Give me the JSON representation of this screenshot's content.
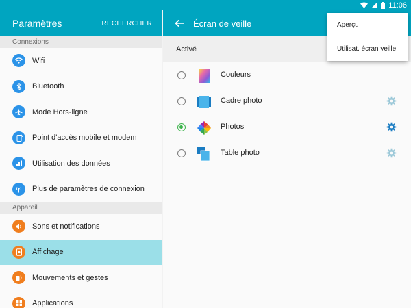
{
  "status": {
    "time": "11:06"
  },
  "settings": {
    "title": "Paramètres",
    "search_label": "RECHERCHER",
    "sections": [
      {
        "label": "Connexions",
        "items": [
          {
            "label": "Wifi",
            "icon": "wifi-icon",
            "color": "#2b93e8"
          },
          {
            "label": "Bluetooth",
            "icon": "bluetooth-icon",
            "color": "#2b93e8"
          },
          {
            "label": "Mode Hors-ligne",
            "icon": "airplane-icon",
            "color": "#2b93e8"
          },
          {
            "label": "Point d'accès mobile et modem",
            "icon": "hotspot-icon",
            "color": "#2b93e8"
          },
          {
            "label": "Utilisation des données",
            "icon": "data-usage-icon",
            "color": "#2b93e8"
          },
          {
            "label": "Plus de paramètres de connexion",
            "icon": "more-connections-icon",
            "color": "#2b93e8"
          }
        ]
      },
      {
        "label": "Appareil",
        "items": [
          {
            "label": "Sons et notifications",
            "icon": "sound-icon",
            "color": "#f07e1e"
          },
          {
            "label": "Affichage",
            "icon": "display-icon",
            "color": "#f07e1e",
            "selected": true
          },
          {
            "label": "Mouvements et gestes",
            "icon": "motion-icon",
            "color": "#f07e1e"
          },
          {
            "label": "Applications",
            "icon": "apps-icon",
            "color": "#f07e1e"
          }
        ]
      }
    ]
  },
  "screensaver": {
    "title": "Écran de veille",
    "active_label": "Activé",
    "options": [
      {
        "label": "Couleurs",
        "icon": "colors-icon",
        "checked": false,
        "has_settings": false
      },
      {
        "label": "Cadre photo",
        "icon": "photo-frame-icon",
        "checked": false,
        "has_settings": true
      },
      {
        "label": "Photos",
        "icon": "photos-icon",
        "checked": true,
        "has_settings": true
      },
      {
        "label": "Table photo",
        "icon": "photo-table-icon",
        "checked": false,
        "has_settings": true
      }
    ]
  },
  "menu": {
    "items": [
      "Aperçu",
      "Utilisat. écran veille"
    ]
  },
  "colors": {
    "accent": "#00a5c0",
    "selected": "#9bdfe8",
    "radio_checked": "#3bb34a"
  }
}
